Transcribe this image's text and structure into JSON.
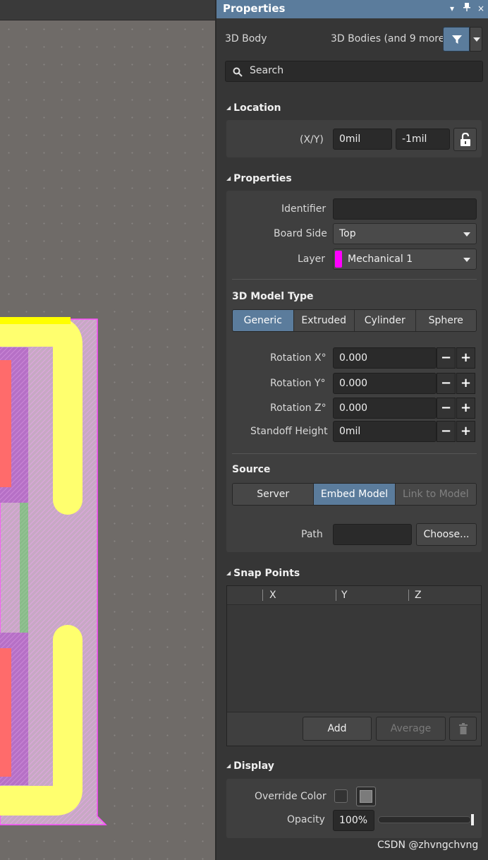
{
  "panel": {
    "title": "Properties",
    "title_buttons": [
      "▾",
      "⊥",
      "×"
    ],
    "object_type": "3D Body",
    "filter_text": "3D Bodies (and 9 more)",
    "search_placeholder": "Search"
  },
  "location": {
    "heading": "Location",
    "xy_label": "(X/Y)",
    "x_value": "0mil",
    "y_value": "-1mil"
  },
  "properties": {
    "heading": "Properties",
    "identifier_label": "Identifier",
    "identifier_value": "",
    "board_side_label": "Board Side",
    "board_side_value": "Top",
    "layer_label": "Layer",
    "layer_value": "Mechanical 1",
    "layer_color": "#ff00ff"
  },
  "model_type": {
    "heading": "3D Model Type",
    "options": [
      "Generic",
      "Extruded",
      "Cylinder",
      "Sphere"
    ],
    "selected": "Generic"
  },
  "rotation": {
    "x_label": "Rotation X°",
    "x_value": "0.000",
    "y_label": "Rotation Y°",
    "y_value": "0.000",
    "z_label": "Rotation Z°",
    "z_value": "0.000",
    "standoff_label": "Standoff Height",
    "standoff_value": "0mil",
    "minus": "−",
    "plus": "+"
  },
  "source": {
    "heading": "Source",
    "options": [
      "Server",
      "Embed Model",
      "Link to Model"
    ],
    "selected": "Embed Model",
    "path_label": "Path",
    "path_value": "",
    "choose_label": "Choose..."
  },
  "snap_points": {
    "heading": "Snap Points",
    "columns": [
      "X",
      "Y",
      "Z"
    ],
    "add_label": "Add",
    "average_label": "Average"
  },
  "display": {
    "heading": "Display",
    "override_label": "Override Color",
    "opacity_label": "Opacity",
    "opacity_value": "100%",
    "opacity_fraction": 1.0
  },
  "watermark": "CSDN @zhvngchvng",
  "colors": {
    "accent": "#5b7c9c",
    "pad_yellow": "#ffff6e",
    "mechanical_magenta": "#ff00ff",
    "canvas_bg": "#6f6b68"
  }
}
